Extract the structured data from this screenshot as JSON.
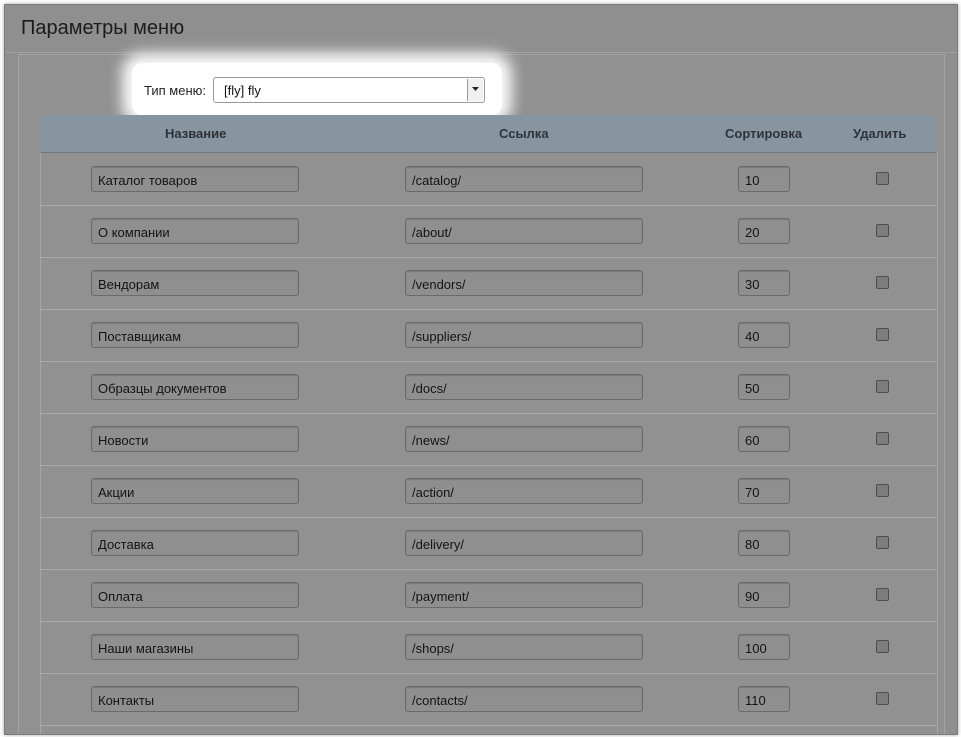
{
  "page": {
    "title": "Параметры меню"
  },
  "menu_type": {
    "label": "Тип меню:",
    "value": "[fly] fly"
  },
  "table": {
    "headers": {
      "name": "Название",
      "link": "Ссылка",
      "sort": "Сортировка",
      "delete": "Удалить"
    },
    "rows": [
      {
        "name": "Каталог товаров",
        "link": "/catalog/",
        "sort": "10",
        "delete": false
      },
      {
        "name": "О компании",
        "link": "/about/",
        "sort": "20",
        "delete": false
      },
      {
        "name": "Вендорам",
        "link": "/vendors/",
        "sort": "30",
        "delete": false
      },
      {
        "name": "Поставщикам",
        "link": "/suppliers/",
        "sort": "40",
        "delete": false
      },
      {
        "name": "Образцы документов",
        "link": "/docs/",
        "sort": "50",
        "delete": false
      },
      {
        "name": "Новости",
        "link": "/news/",
        "sort": "60",
        "delete": false
      },
      {
        "name": "Акции",
        "link": "/action/",
        "sort": "70",
        "delete": false
      },
      {
        "name": "Доставка",
        "link": "/delivery/",
        "sort": "80",
        "delete": false
      },
      {
        "name": "Оплата",
        "link": "/payment/",
        "sort": "90",
        "delete": false
      },
      {
        "name": "Наши магазины",
        "link": "/shops/",
        "sort": "100",
        "delete": false
      },
      {
        "name": "Контакты",
        "link": "/contacts/",
        "sort": "110",
        "delete": false
      }
    ]
  }
}
